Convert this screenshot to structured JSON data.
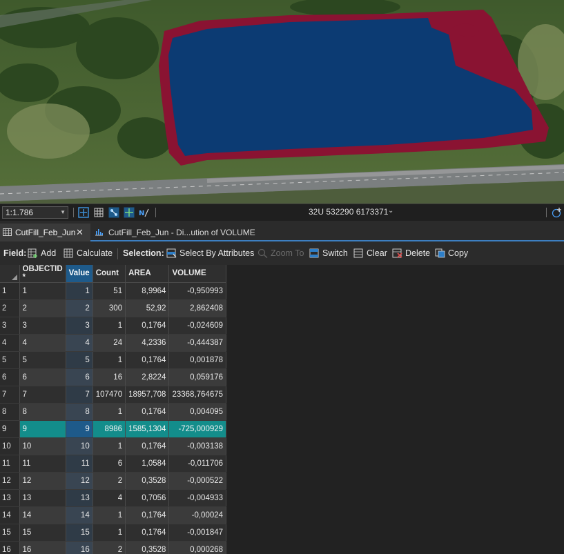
{
  "map": {
    "scale": "1:1.786",
    "coordinates": "32U 532290 6173371",
    "icons": [
      "extent-indicator-icon",
      "grid-icon",
      "snapping-icon",
      "constraints-icon",
      "north-arrow-icon",
      "add-to-map-icon"
    ]
  },
  "tabs": [
    {
      "label": "CutFill_Feb_Jun",
      "icon": "table-icon",
      "active": true
    },
    {
      "label": "CutFill_Feb_Jun - Di...ution of VOLUME",
      "icon": "chart-icon",
      "active": false
    }
  ],
  "toolbar": {
    "field_label": "Field:",
    "add_label": "Add",
    "calculate_label": "Calculate",
    "selection_label": "Selection:",
    "select_by_attributes_label": "Select By Attributes",
    "zoom_to_label": "Zoom To",
    "switch_label": "Switch",
    "clear_label": "Clear",
    "delete_label": "Delete",
    "copy_label": "Copy"
  },
  "table": {
    "columns": [
      "OBJECTID *",
      "Value",
      "Count",
      "AREA",
      "VOLUME"
    ],
    "sorted_column": "Value",
    "selected_row": 9,
    "rows": [
      {
        "row": "1",
        "objectid": "1",
        "value": "1",
        "count": "51",
        "area": "8,9964",
        "volume": "-0,950993"
      },
      {
        "row": "2",
        "objectid": "2",
        "value": "2",
        "count": "300",
        "area": "52,92",
        "volume": "2,862408"
      },
      {
        "row": "3",
        "objectid": "3",
        "value": "3",
        "count": "1",
        "area": "0,1764",
        "volume": "-0,024609"
      },
      {
        "row": "4",
        "objectid": "4",
        "value": "4",
        "count": "24",
        "area": "4,2336",
        "volume": "-0,444387"
      },
      {
        "row": "5",
        "objectid": "5",
        "value": "5",
        "count": "1",
        "area": "0,1764",
        "volume": "0,001878"
      },
      {
        "row": "6",
        "objectid": "6",
        "value": "6",
        "count": "16",
        "area": "2,8224",
        "volume": "0,059176"
      },
      {
        "row": "7",
        "objectid": "7",
        "value": "7",
        "count": "107470",
        "area": "18957,708",
        "volume": "23368,764675"
      },
      {
        "row": "8",
        "objectid": "8",
        "value": "8",
        "count": "1",
        "area": "0,1764",
        "volume": "0,004095"
      },
      {
        "row": "9",
        "objectid": "9",
        "value": "9",
        "count": "8986",
        "area": "1585,1304",
        "volume": "-725,000929"
      },
      {
        "row": "10",
        "objectid": "10",
        "value": "10",
        "count": "1",
        "area": "0,1764",
        "volume": "-0,003138"
      },
      {
        "row": "11",
        "objectid": "11",
        "value": "11",
        "count": "6",
        "area": "1,0584",
        "volume": "-0,011706"
      },
      {
        "row": "12",
        "objectid": "12",
        "value": "12",
        "count": "2",
        "area": "0,3528",
        "volume": "-0,000522"
      },
      {
        "row": "13",
        "objectid": "13",
        "value": "13",
        "count": "4",
        "area": "0,7056",
        "volume": "-0,004933"
      },
      {
        "row": "14",
        "objectid": "14",
        "value": "14",
        "count": "1",
        "area": "0,1764",
        "volume": "-0,00024"
      },
      {
        "row": "15",
        "objectid": "15",
        "value": "15",
        "count": "1",
        "area": "0,1764",
        "volume": "-0,001847"
      },
      {
        "row": "16",
        "objectid": "16",
        "value": "16",
        "count": "2",
        "area": "0,3528",
        "volume": "0,000268"
      }
    ]
  },
  "colors": {
    "cut_fill_net_loss": "#8a1332",
    "cut_fill_net_gain": "#0c3b73",
    "selection_highlight": "#138d8b",
    "sorted_header": "#1e5a8a"
  }
}
